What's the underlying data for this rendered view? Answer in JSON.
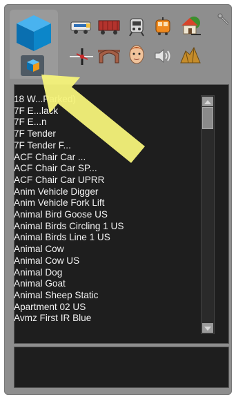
{
  "toolbar": {
    "icons": [
      "locomotive-icon",
      "freight-car-icon",
      "passenger-car-icon",
      "tram-icon",
      "house-icon",
      "signal-icon",
      "bridge-icon",
      "person-icon",
      "speaker-icon",
      "rocks-icon"
    ]
  },
  "list": {
    "items": [
      "18 W...Parked)",
      "7F E...lack",
      "7F E...n",
      "7F Tender",
      "7F Tender F...",
      "ACF Chair Car ...",
      "ACF Chair Car SP...",
      "ACF Chair Car UPRR",
      "Anim Vehicle Digger",
      "Anim Vehicle Fork Lift",
      "Animal Bird Goose US",
      "Animal Birds Circling 1 US",
      "Animal Birds Line 1 US",
      "Animal Cow",
      "Animal Cow US",
      "Animal Dog",
      "Animal Goat",
      "Animal Sheep Static",
      "Apartment 02 US",
      "Avmz First IR Blue"
    ]
  },
  "colors": {
    "panel": "#8e8e8e",
    "list_bg": "#1e1e1e",
    "list_text": "#f2f2f2",
    "arrow": "#f6f37a"
  }
}
